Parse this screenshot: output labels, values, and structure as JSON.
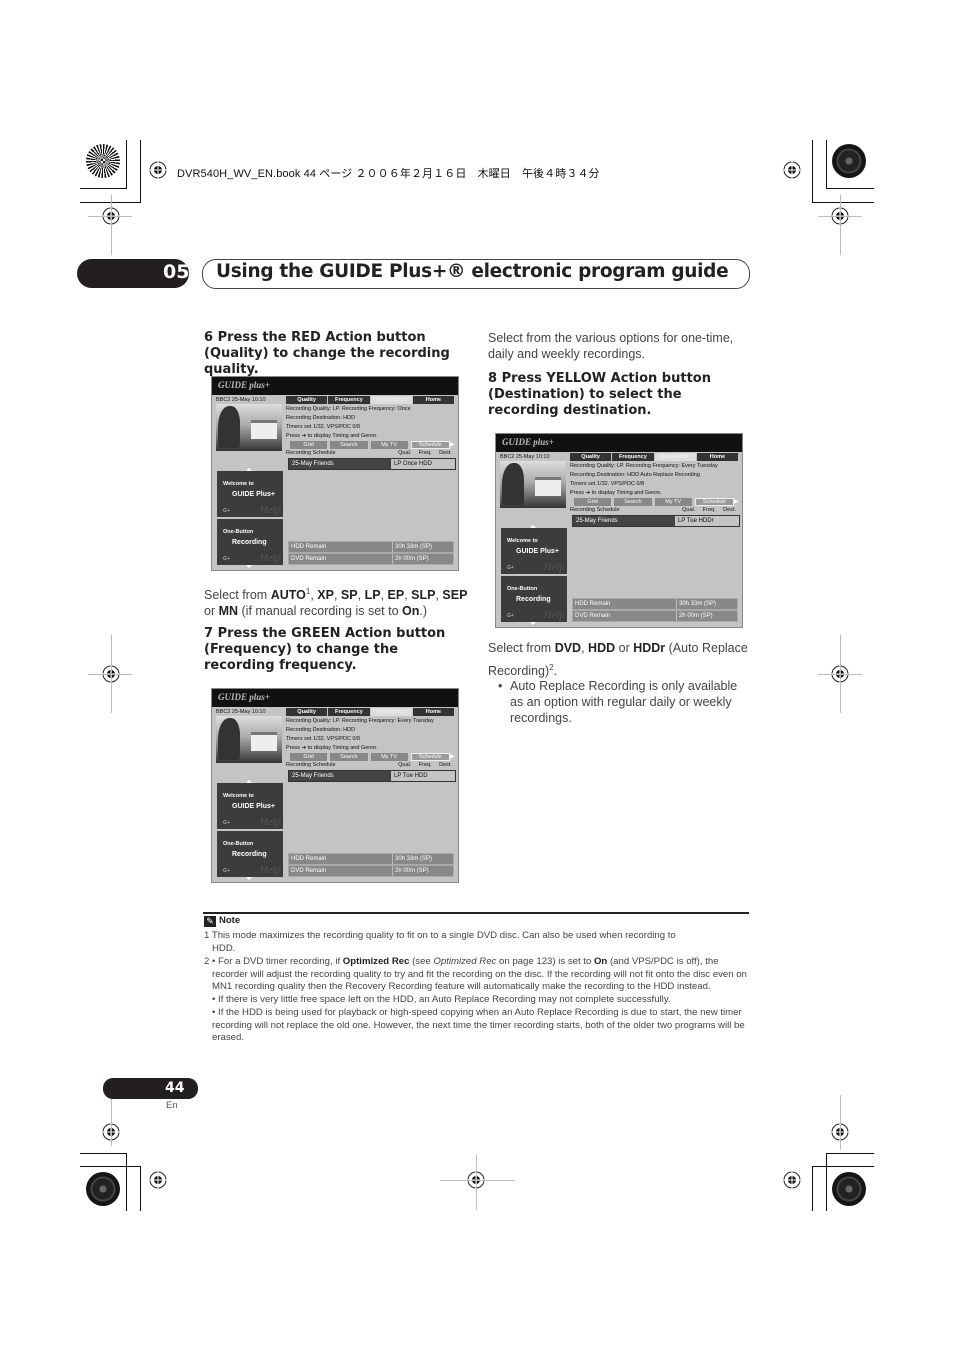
{
  "header": {
    "file_info": "DVR540H_WV_EN.book  44 ページ  ２００６年２月１６日　木曜日　午後４時３４分"
  },
  "chapter": {
    "number": "05",
    "title": "Using the GUIDE Plus+® electronic program guide"
  },
  "steps": {
    "step6": {
      "heading": "6    Press the RED Action button (Quality) to change the recording quality.",
      "select_prefix": "Select from ",
      "options": [
        "AUTO",
        "XP",
        "SP",
        "LP",
        "EP",
        "SLP",
        "SEP"
      ],
      "footnote_ref": "1",
      "or_text": "or ",
      "manual_option": "MN",
      "manual_note": " (if manual recording is set to ",
      "on_text": "On",
      "end": ".)"
    },
    "step7": {
      "heading": "7    Press the GREEN Action button (Frequency) to change the recording frequency.",
      "body": "Select from the various options for one-time, daily and weekly recordings."
    },
    "step8": {
      "heading": "8    Press YELLOW Action button (Destination) to select the recording destination.",
      "select_prefix": "Select from ",
      "opt1": "DVD",
      "opt2": "HDD",
      "or_text": " or ",
      "opt3": "HDDr",
      "paren": " (Auto Replace Recording)",
      "footnote_ref": "2",
      "period": ".",
      "bullet": "Auto Replace Recording is only available as an option with regular daily or weekly recordings."
    }
  },
  "screens": [
    {
      "logo": "GUIDE plus+",
      "channel_info": "BBC2   25-May  10:10",
      "tabs": [
        "Quality",
        "Frequency",
        "Destination",
        "Home"
      ],
      "active_tab": "Destination",
      "info_lines": [
        "Recording Quality: LP. Recording Frequency: Once",
        "Recording Destination: HDD",
        "Timers set 1/32.  VPS/PDC 0/8",
        "Press ➔ to display Timing and Genre."
      ],
      "subtabs": [
        "Grid",
        "Search",
        "My TV",
        "Schedule"
      ],
      "schedule_header": "Recording Schedule",
      "schedule_cols": "Qual.  Freq.  Dest.",
      "schedule_row_name": "25-May  Friends",
      "schedule_row_vals": "LP      Once   HDD",
      "side1_line1": "Welcome to",
      "side1_line2": "GUIDE Plus+",
      "side2_line1": "One-Button",
      "side2_line2": "Recording",
      "help_text": "Help",
      "remain": [
        {
          "label": "HDD Remain",
          "value": "30h 33m (SP)"
        },
        {
          "label": "DVD Remain",
          "value": "2h 00m (SP)"
        }
      ]
    },
    {
      "logo": "GUIDE plus+",
      "channel_info": "BBC2   25-May  10:10",
      "tabs": [
        "Quality",
        "Frequency",
        "Destination",
        "Home"
      ],
      "active_tab": "Destination",
      "info_lines": [
        "Recording Quality: LP. Recording Frequency: Every Tuesday",
        "Recording Destination: HDD",
        "Timers set 1/32.  VPS/PDC 0/8",
        "Press ➔ to display Timing and Genre."
      ],
      "subtabs": [
        "Grid",
        "Search",
        "My TV",
        "Schedule"
      ],
      "schedule_header": "Recording Schedule",
      "schedule_cols": "Qual.  Freq.  Dest.",
      "schedule_row_name": "25-May  Friends",
      "schedule_row_vals": "LP      Tue    HDD",
      "side1_line1": "Welcome to",
      "side1_line2": "GUIDE Plus+",
      "side2_line1": "One-Button",
      "side2_line2": "Recording",
      "help_text": "Help",
      "remain": [
        {
          "label": "HDD Remain",
          "value": "30h 33m (SP)"
        },
        {
          "label": "DVD Remain",
          "value": "2h 00m (SP)"
        }
      ]
    },
    {
      "logo": "GUIDE plus+",
      "channel_info": "BBC2   25-May  10:10",
      "tabs": [
        "Quality",
        "Frequency",
        "Destination",
        "Home"
      ],
      "active_tab": "Destination",
      "info_lines": [
        "Recording Quality: LP. Recording Frequency: Every Tuesday",
        "Recording Destination: HDD Auto Replace Recording",
        "Timers set 1/32.  VPS/PDC 0/8",
        "Press ➔ to display Timing and Genre."
      ],
      "subtabs": [
        "Grid",
        "Search",
        "My TV",
        "Schedule"
      ],
      "schedule_header": "Recording Schedule",
      "schedule_cols": "Qual.  Freq.  Dest.",
      "schedule_row_name": "25-May  Friends",
      "schedule_row_vals": "LP      Tue    HDDr",
      "side1_line1": "Welcome to",
      "side1_line2": "GUIDE Plus+",
      "side2_line1": "One-Button",
      "side2_line2": "Recording",
      "help_text": "Help",
      "remain": [
        {
          "label": "HDD Remain",
          "value": "30h 33m (SP)"
        },
        {
          "label": "DVD Remain",
          "value": "2h 00m (SP)"
        }
      ]
    }
  ],
  "note": {
    "label": "Note",
    "fn1": "1 This mode maximizes the recording quality to fit on to a single DVD disc. Can also be used when recording to",
    "fn1_cont": "HDD.",
    "fn2_prefix": "2 • For a DVD timer recording, if ",
    "fn2_bold1": "Optimized Rec",
    "fn2_mid1": " (see ",
    "fn2_italic": "Optimized Rec",
    "fn2_mid2": " on page 123) is set to ",
    "fn2_bold2": "On",
    "fn2_rest": " (and VPS/PDC is off), the recorder will adjust the recording quality to try and fit the recording on the disc. If the recording will not fit onto the disc even on MN1 recording quality then the Recovery Recording feature will automatically make the recording to the HDD instead.",
    "fn2_b2": "• If there is very little free space left on the HDD, an Auto Replace Recording may not complete successfully.",
    "fn2_b3": "• If the HDD is being used for playback or high-speed copying when an Auto Replace Recording is due to start, the new timer recording will not replace the old one. However, the next time the timer recording starts, both of the older two programs will be erased."
  },
  "footer": {
    "page_number": "44",
    "language": "En"
  }
}
